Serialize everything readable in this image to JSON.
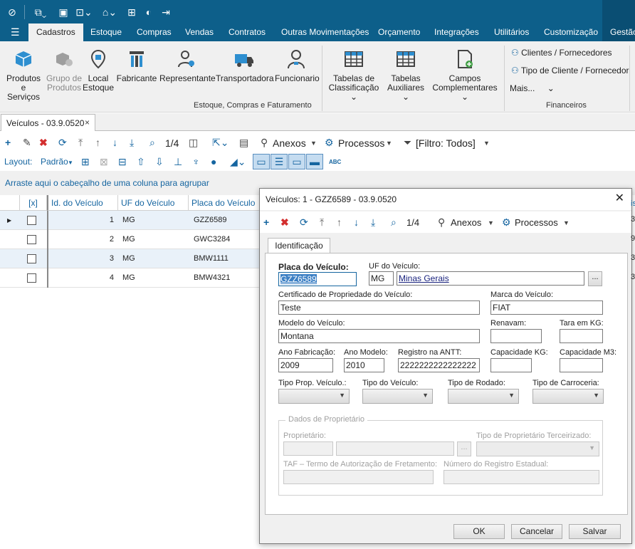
{
  "menubar": {
    "items": [
      "Cadastros",
      "Estoque",
      "Compras",
      "Vendas",
      "Contratos",
      "Outras Movimentações",
      "Orçamento",
      "Integrações",
      "Utilitários",
      "Customização",
      "Gestão"
    ],
    "active": "Cadastros"
  },
  "ribbon": {
    "buttons": [
      {
        "line1": "Produtos e",
        "line2": "Serviços"
      },
      {
        "line1": "Grupo de",
        "line2": "Produtos"
      },
      {
        "line1": "Local",
        "line2": "Estoque"
      },
      {
        "line1": "Fabricante",
        "line2": ""
      },
      {
        "line1": "Representante",
        "line2": ""
      },
      {
        "line1": "Transportadora",
        "line2": ""
      },
      {
        "line1": "Funcionario",
        "line2": ""
      },
      {
        "line1": "Tabelas de",
        "line2": "Classificação ⌄"
      },
      {
        "line1": "Tabelas",
        "line2": "Auxiliares ⌄"
      },
      {
        "line1": "Campos",
        "line2": "Complementares ⌄"
      }
    ],
    "group1_label": "Estoque, Compras e Faturamento",
    "group2_label": "Financeiros",
    "fin_item1": "Clientes / Fornecedores",
    "fin_item2": "Tipo de Cliente / Fornecedor",
    "fin_more": "Mais...",
    "fin_more_chevron": "⌄"
  },
  "doc_tab": {
    "label": "Veículos - 03.9.0520",
    "close": "×"
  },
  "toolbar": {
    "counter": "1/4",
    "anexos": "Anexos",
    "processos": "Processos",
    "filter": "[Filtro: Todos]",
    "layout_label": "Layout:",
    "layout_value": "Padrão"
  },
  "group_hint": "Arraste aqui o cabeçalho de uma coluna para agrupar",
  "grid": {
    "columns": [
      "[x]",
      "Id. do Veículo",
      "UF do Veículo",
      "Placa do Veículo"
    ],
    "rows": [
      {
        "id": "1",
        "uf": "MG",
        "placa": "GZZ6589"
      },
      {
        "id": "2",
        "uf": "MG",
        "placa": "GWC3284"
      },
      {
        "id": "3",
        "uf": "MG",
        "placa": "BMW1111"
      },
      {
        "id": "4",
        "uf": "MG",
        "placa": "BMW4321"
      }
    ]
  },
  "dialog": {
    "title": "Veículos: 1 - GZZ6589 - 03.9.0520",
    "counter": "1/4",
    "anexos": "Anexos",
    "processos": "Processos",
    "tab": "Identificação",
    "fields": {
      "placa_label": "Placa do Veículo:",
      "placa_value": "GZZ6589",
      "uf_label": "UF do Veículo:",
      "uf_code": "MG",
      "uf_name": "Minas Gerais",
      "cert_label": "Certificado de Propriedade do Veículo:",
      "cert_value": "Teste",
      "marca_label": "Marca do Veículo:",
      "marca_value": "FIAT",
      "modelo_label": "Modelo do Veículo:",
      "modelo_value": "Montana",
      "renavam_label": "Renavam:",
      "tara_label": "Tara em KG:",
      "ano_fab_label": "Ano Fabricação:",
      "ano_fab_value": "2009",
      "ano_mod_label": "Ano Modelo:",
      "ano_mod_value": "2010",
      "antt_label": "Registro na ANTT:",
      "antt_value": "2222222222222222",
      "cap_kg_label": "Capacidade KG:",
      "cap_m3_label": "Capacidade M3:",
      "tipo_prop_label": "Tipo Prop. Veículo.:",
      "tipo_veic_label": "Tipo do Veículo:",
      "tipo_rod_label": "Tipo de Rodado:",
      "tipo_carr_label": "Tipo de Carroceria:",
      "dados_prop_legend": "Dados de Proprietário",
      "proprietario_label": "Proprietário:",
      "tipo_prop_terc_label": "Tipo de Proprietário Terceirizado:",
      "taf_label": "TAF – Termo de Autorização de Fretamento:",
      "reg_est_label": "Número do Registro Estadual:"
    },
    "buttons": {
      "ok": "OK",
      "cancel": "Cancelar",
      "save": "Salvar"
    }
  }
}
